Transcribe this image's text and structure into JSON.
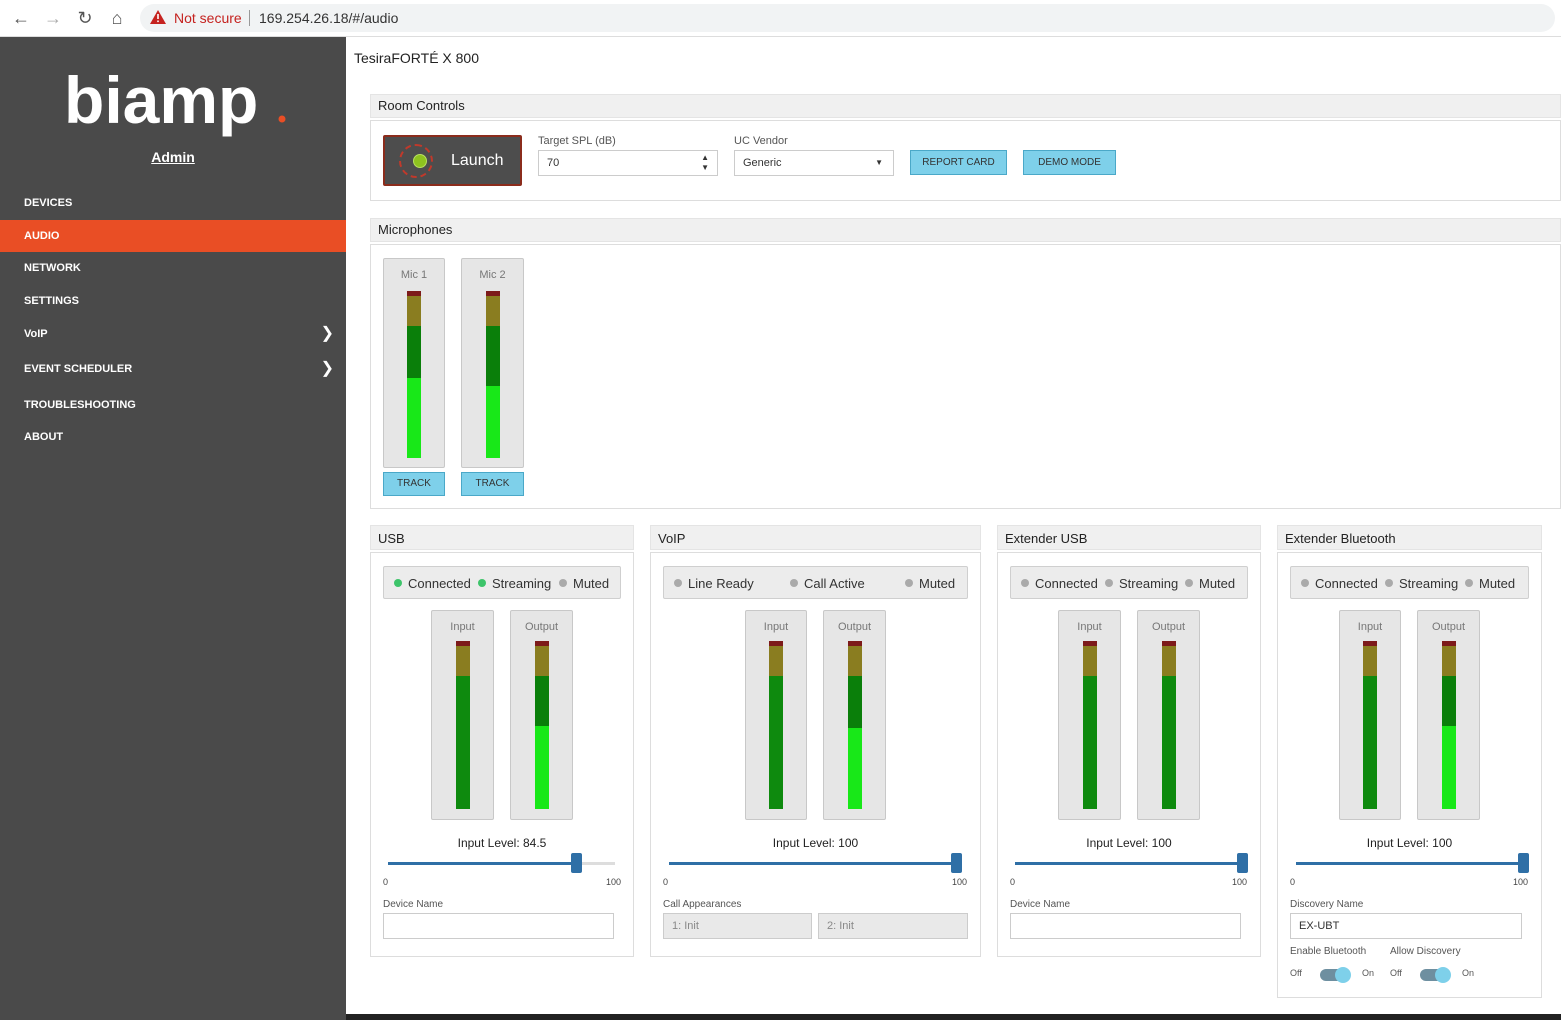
{
  "browser": {
    "not_secure": "Not secure",
    "url": "169.254.26.18/#/audio"
  },
  "sidebar": {
    "logo_text": "biamp",
    "user": "Admin",
    "items": [
      {
        "label": "DEVICES",
        "active": false
      },
      {
        "label": "AUDIO",
        "active": true
      },
      {
        "label": "NETWORK",
        "active": false
      },
      {
        "label": "SETTINGS",
        "active": false
      },
      {
        "label": "VoIP",
        "active": false,
        "expandable": true
      },
      {
        "label": "EVENT SCHEDULER",
        "active": false,
        "expandable": true
      },
      {
        "label": "TROUBLESHOOTING",
        "active": false
      },
      {
        "label": "ABOUT",
        "active": false
      }
    ]
  },
  "page": {
    "title": "TesiraFORTÉ X 800"
  },
  "room_controls": {
    "heading": "Room Controls",
    "launch_label": "Launch",
    "target_spl_label": "Target SPL (dB)",
    "target_spl_value": "70",
    "uc_vendor_label": "UC Vendor",
    "uc_vendor_value": "Generic",
    "report_card_label": "REPORT CARD",
    "demo_mode_label": "DEMO MODE"
  },
  "microphones": {
    "heading": "Microphones",
    "mics": [
      {
        "label": "Mic 1",
        "track_label": "TRACK",
        "level": 0.4
      },
      {
        "label": "Mic 2",
        "track_label": "TRACK",
        "level": 0.45
      }
    ]
  },
  "usb": {
    "heading": "USB",
    "status": [
      {
        "label": "Connected",
        "on": true
      },
      {
        "label": "Streaming",
        "on": true
      },
      {
        "label": "Muted",
        "on": false
      }
    ],
    "input_label": "Input",
    "output_label": "Output",
    "input_level_text": "Input Level: 84.5",
    "input_level": 84.5,
    "min": "0",
    "max": "100",
    "field_label": "Device Name",
    "field_value": ""
  },
  "voip": {
    "heading": "VoIP",
    "status": [
      {
        "label": "Line Ready",
        "on": false
      },
      {
        "label": "Call Active",
        "on": false
      },
      {
        "label": "Muted",
        "on": false
      }
    ],
    "input_label": "Input",
    "output_label": "Output",
    "input_level_text": "Input Level: 100",
    "input_level": 100,
    "min": "0",
    "max": "100",
    "call_appearances_label": "Call Appearances",
    "call_1": "1: Init",
    "call_2": "2: Init"
  },
  "extender_usb": {
    "heading": "Extender USB",
    "status": [
      {
        "label": "Connected",
        "on": false
      },
      {
        "label": "Streaming",
        "on": false
      },
      {
        "label": "Muted",
        "on": false
      }
    ],
    "input_label": "Input",
    "output_label": "Output",
    "input_level_text": "Input Level: 100",
    "input_level": 100,
    "min": "0",
    "max": "100",
    "field_label": "Device Name",
    "field_value": ""
  },
  "extender_bluetooth": {
    "heading": "Extender Bluetooth",
    "status": [
      {
        "label": "Connected",
        "on": false
      },
      {
        "label": "Streaming",
        "on": false
      },
      {
        "label": "Muted",
        "on": false
      }
    ],
    "input_label": "Input",
    "output_label": "Output",
    "input_level_text": "Input Level: 100",
    "input_level": 100,
    "min": "0",
    "max": "100",
    "field_label": "Discovery Name",
    "field_value": "EX-UBT",
    "enable_bt_label": "Enable Bluetooth",
    "allow_disc_label": "Allow Discovery",
    "off_label": "Off",
    "on_label": "On"
  },
  "colors": {
    "accent": "#e94e25",
    "sidebar": "#4a4a4a",
    "button": "#7ed0ea",
    "slider": "#2f6fa6"
  }
}
